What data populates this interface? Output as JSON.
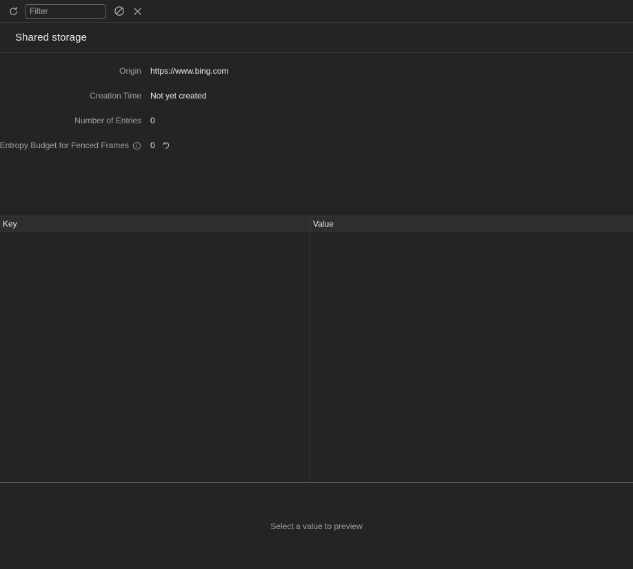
{
  "toolbar": {
    "refresh_label": "refresh-icon",
    "clear_label": "clear-icon",
    "close_label": "close-icon",
    "filter_placeholder": "Filter",
    "filter_value": ""
  },
  "header": {
    "title": "Shared storage"
  },
  "metadata": [
    {
      "label": "Origin",
      "value": "https://www.bing.com",
      "has_info": false,
      "has_reset": false
    },
    {
      "label": "Creation Time",
      "value": "Not yet created",
      "has_info": false,
      "has_reset": false
    },
    {
      "label": "Number of Entries",
      "value": "0",
      "has_info": false,
      "has_reset": false
    },
    {
      "label": "Entropy Budget for Fenced Frames",
      "value": "0",
      "has_info": true,
      "has_reset": true
    }
  ],
  "table": {
    "columns": [
      {
        "key": "key",
        "label": "Key"
      },
      {
        "key": "value",
        "label": "Value"
      }
    ],
    "rows": []
  },
  "preview": {
    "empty_text": "Select a value to preview"
  },
  "colors": {
    "background": "#242424",
    "header_row": "#2e2e2e",
    "border": "#3b3b3b",
    "splitter": "#5a5a5a",
    "text_primary": "#e8eaed",
    "text_secondary": "#9aa0a6",
    "input_border": "#5f6368"
  }
}
